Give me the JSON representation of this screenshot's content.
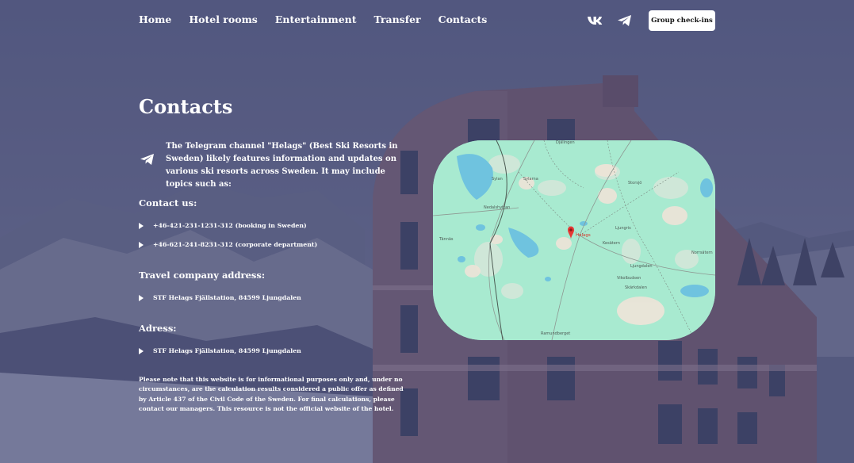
{
  "header": {
    "nav": [
      "Home",
      "Hotel rooms",
      "Entertainment",
      "Transfer",
      "Contacts"
    ],
    "social_icons": [
      "vk-icon",
      "telegram-icon"
    ],
    "checkin_button": "Group check-ins"
  },
  "page": {
    "title": "Contacts",
    "intro_icon": "telegram-icon",
    "intro": "The Telegram channel \"Helags\" (Best Ski Resorts in Sweden) likely features information and updates on various ski resorts across Sweden. It may include topics such as:"
  },
  "contact": {
    "heading": "Contact us:",
    "phone1": "+46-421-231-1231-312 (booking in Sweden)",
    "phone2": "+46-621-241-8231-312 (corporate department)"
  },
  "travel": {
    "heading": "Travel company address:",
    "address": "STF Helags Fjällstation, 84599 Ljungdalen"
  },
  "adress": {
    "heading": "Adress:",
    "address": "STF Helags Fjällstation, 84599 Ljungdalen"
  },
  "notice": "Please note that this website is for informational purposes only and, under no circumstances, are the calculation results considered a public offer as defined by Article 437 of the Civil Code of the Sweden. For final calculations, please contact our managers. This resource is not the official website of the hotel.",
  "map": {
    "marker_label": "Helags",
    "places": [
      "Djälingen",
      "Sylan",
      "Sylarna",
      "Nedalshyttan",
      "Tännäs",
      "Storsjö",
      "Ljungris",
      "Kesätern",
      "Norrsätern",
      "Ljungdalen",
      "Vikolbudsen",
      "Skärkdalen",
      "Ramundberget"
    ],
    "colors": {
      "land": "#a8ead0",
      "water": "#6fc3df",
      "marker": "#e53935"
    }
  }
}
